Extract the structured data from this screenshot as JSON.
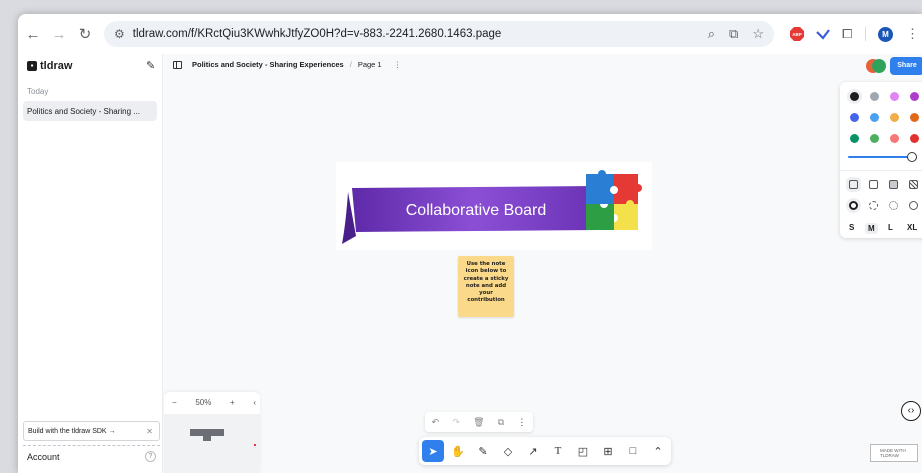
{
  "browser": {
    "url": "tldraw.com/f/KRctQiu3KWwhkJtfyZO0H?d=v-883.-2241.2680.1463.page",
    "profile_initial": "M",
    "abp_label": "ABP"
  },
  "sidebar": {
    "brand": "tldraw",
    "section_label": "Today",
    "files": [
      "Politics and Society - Sharing ..."
    ],
    "sdk_banner": "Build with the tldraw SDK →",
    "account_label": "Account",
    "help_label": "?"
  },
  "header": {
    "board_title": "Politics and Society - Sharing Experiences",
    "separator": "/",
    "page_name": "Page 1",
    "share_label": "Share"
  },
  "style_panel": {
    "colors": [
      "#1d1d1d",
      "#9fa8b2",
      "#e085f4",
      "#ae3ec9",
      "#4465e9",
      "#4ba1f1",
      "#f1ac4b",
      "#e16919",
      "#099268",
      "#4cb05e",
      "#f87777",
      "#e03131"
    ],
    "opacity": 1.0,
    "sizes": [
      "S",
      "M",
      "L",
      "XL"
    ],
    "selected_size": "M"
  },
  "canvas": {
    "banner_text": "Collaborative Board",
    "sticky_text": "Use the note icon below to create a sticky note and add your contribution"
  },
  "zoom": {
    "minus": "−",
    "level": "50%",
    "plus": "+",
    "collapse": "‹"
  },
  "footer": {
    "made_with_line1": "MADE WITH",
    "made_with_line2": "TLDRAW"
  },
  "colors": {
    "accent": "#2f80ed",
    "banner_purple": "#7b3fc4",
    "sticky_yellow": "#fbd98b"
  }
}
